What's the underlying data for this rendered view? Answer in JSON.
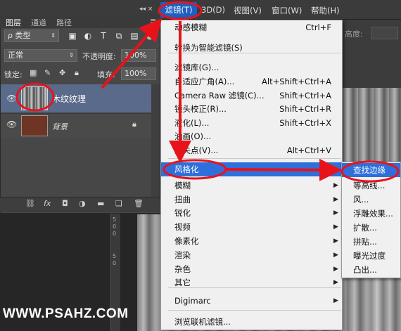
{
  "menubar": {
    "panel_controls": "◂◂  ×",
    "items": [
      "滤镜(T)",
      "3D(D)",
      "视图(V)",
      "窗口(W)",
      "帮助(H)"
    ]
  },
  "layers_panel": {
    "tabs": [
      "图层",
      "通道",
      "路径"
    ],
    "kind_filter": "ρ 类型",
    "blend_mode": "正常",
    "opacity_label": "不透明度:",
    "opacity_value": "100%",
    "lock_label": "锁定:",
    "fill_label": "填充:",
    "fill_value": "100%",
    "layers": [
      {
        "name": "木纹纹理",
        "selected": true
      },
      {
        "name": "背景",
        "locked": true
      }
    ],
    "bottom_icons": [
      "link-icon",
      "fx-icon",
      "mask-icon",
      "adjustment-icon",
      "folder-icon",
      "new-layer-icon",
      "trash-icon"
    ]
  },
  "right_panel": {
    "opacity_label": "高度:"
  },
  "filter_menu": {
    "items": [
      {
        "label": "动感模糊",
        "shortcut": "Ctrl+F"
      },
      {
        "label": "转换为智能滤镜(S)",
        "shortcut": ""
      },
      {
        "label": "滤镜库(G)...",
        "shortcut": ""
      },
      {
        "label": "自适应广角(A)...",
        "shortcut": "Alt+Shift+Ctrl+A"
      },
      {
        "label": "Camera Raw 滤镜(C)...",
        "shortcut": "Shift+Ctrl+A"
      },
      {
        "label": "镜头校正(R)...",
        "shortcut": "Shift+Ctrl+R"
      },
      {
        "label": "液化(L)...",
        "shortcut": "Shift+Ctrl+X"
      },
      {
        "label": "油画(O)...",
        "shortcut": ""
      },
      {
        "label": "消失点(V)...",
        "shortcut": "Alt+Ctrl+V"
      },
      {
        "label": "风格化",
        "shortcut": "",
        "submenu": true,
        "highlighted": true
      },
      {
        "label": "模糊",
        "shortcut": "",
        "submenu": true
      },
      {
        "label": "扭曲",
        "shortcut": "",
        "submenu": true
      },
      {
        "label": "锐化",
        "shortcut": "",
        "submenu": true
      },
      {
        "label": "视频",
        "shortcut": "",
        "submenu": true
      },
      {
        "label": "像素化",
        "shortcut": "",
        "submenu": true
      },
      {
        "label": "渲染",
        "shortcut": "",
        "submenu": true
      },
      {
        "label": "杂色",
        "shortcut": "",
        "submenu": true
      },
      {
        "label": "其它",
        "shortcut": "",
        "submenu": true
      },
      {
        "label": "Digimarc",
        "shortcut": "",
        "submenu": true
      },
      {
        "label": "浏览联机滤镜...",
        "shortcut": ""
      }
    ]
  },
  "stylize_submenu": {
    "items": [
      "查找边缘",
      "等高线...",
      "风...",
      "浮雕效果...",
      "扩散...",
      "拼贴...",
      "曝光过度",
      "凸出..."
    ]
  },
  "ruler_numbers": [
    "5",
    "0",
    "0",
    "5",
    "0"
  ],
  "watermark": "WWW.PSAHZ.COM",
  "colors": {
    "highlight": "#2f6fdb",
    "annotation": "#e8121b",
    "selected_layer": "#596a8a"
  }
}
